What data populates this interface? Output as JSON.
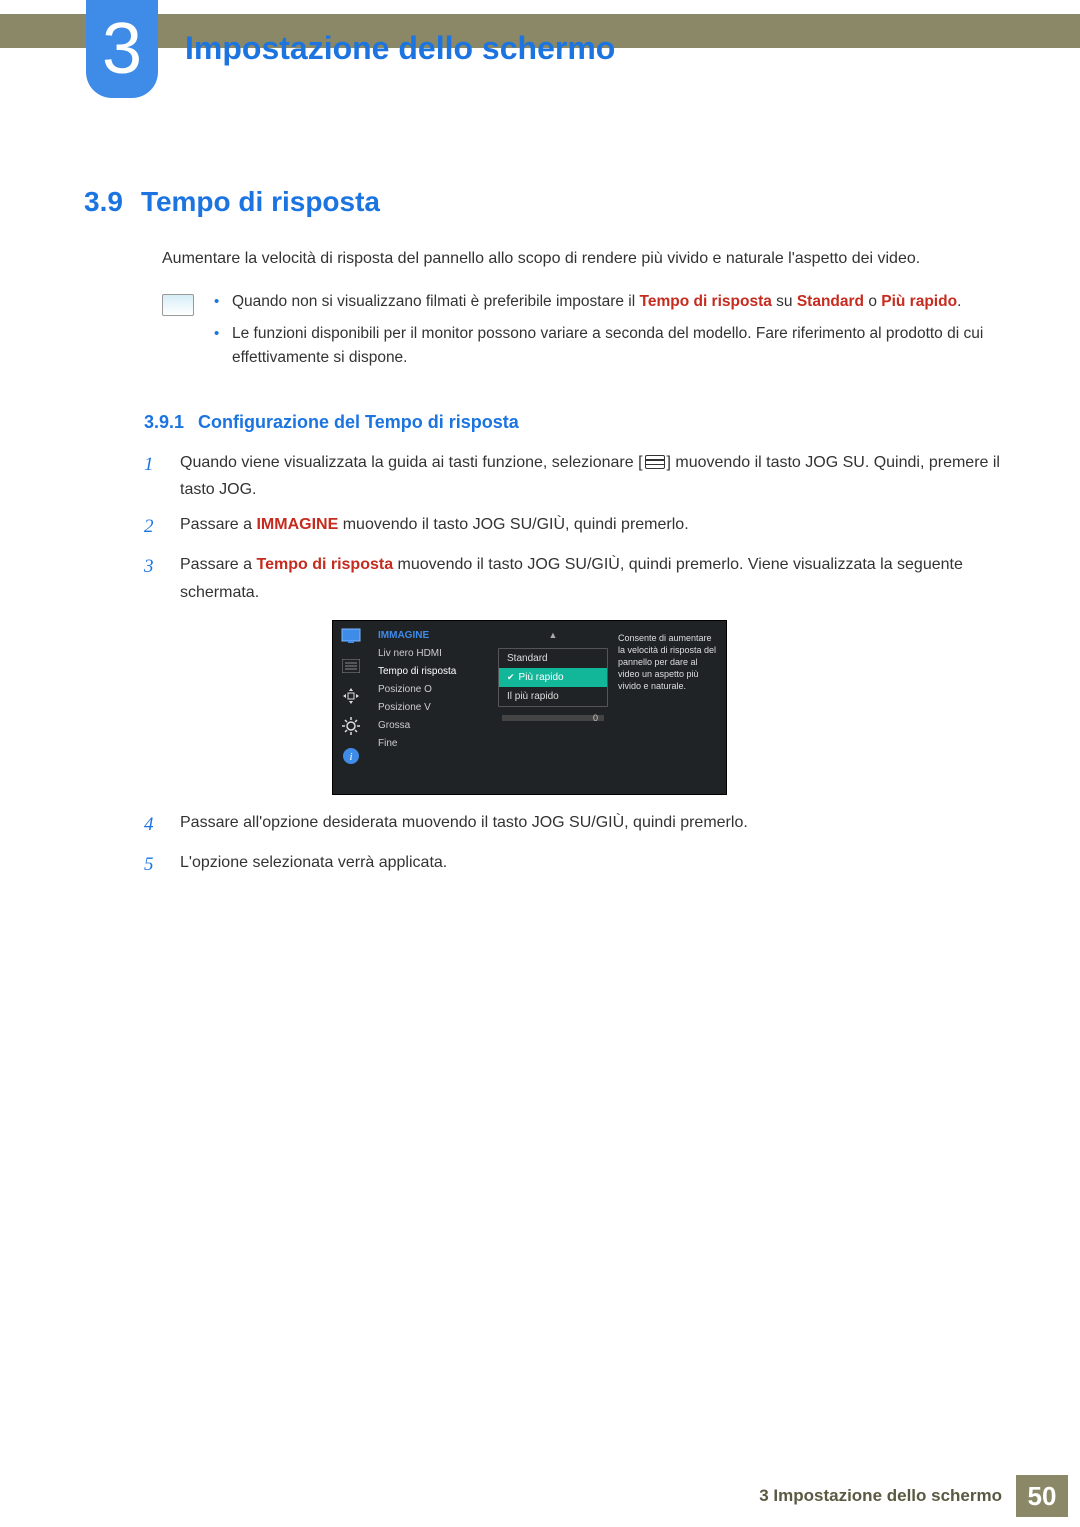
{
  "chapter": {
    "number": "3",
    "title": "Impostazione dello schermo"
  },
  "section": {
    "number": "3.9",
    "title": "Tempo di risposta"
  },
  "intro": "Aumentare la velocità di risposta del pannello allo scopo di rendere più vivido e naturale l'aspetto dei video.",
  "notes": {
    "item1_pre": "Quando non si visualizzano filmati è preferibile impostare il ",
    "item1_b1": "Tempo di risposta",
    "item1_mid": " su ",
    "item1_b2": "Standard",
    "item1_or": " o ",
    "item1_b3": "Più rapido",
    "item1_end": ".",
    "item2": "Le funzioni disponibili per il monitor possono variare a seconda del modello. Fare riferimento al prodotto di cui effettivamente si dispone."
  },
  "subsection": {
    "number": "3.9.1",
    "title": "Configurazione del Tempo di risposta"
  },
  "steps": {
    "s1a": "Quando viene visualizzata la guida ai tasti funzione, selezionare [",
    "s1b": "] muovendo il tasto JOG SU. Quindi, premere il tasto JOG.",
    "s2a": "Passare a ",
    "s2b": "IMMAGINE",
    "s2c": " muovendo il tasto JOG SU/GIÙ, quindi premerlo.",
    "s3a": "Passare a ",
    "s3b": "Tempo di risposta",
    "s3c": " muovendo il tasto JOG SU/GIÙ, quindi premerlo. Viene visualizzata la seguente schermata.",
    "s4": "Passare all'opzione desiderata muovendo il tasto JOG SU/GIÙ, quindi premerlo.",
    "s5": "L'opzione selezionata verrà applicata."
  },
  "osd": {
    "menu_title": "IMMAGINE",
    "m1": "Liv nero HDMI",
    "m2": "Tempo di risposta",
    "m3": "Posizione O",
    "m4": "Posizione V",
    "m5": "Grossa",
    "m6": "Fine",
    "opt1": "Standard",
    "opt2": "Più rapido",
    "opt3": "Il più rapido",
    "slider_val": "0",
    "desc": "Consente di aumentare la velocità di risposta del pannello per dare al video un aspetto più vivido e naturale."
  },
  "footer": {
    "text": "3 Impostazione dello schermo",
    "page": "50"
  }
}
